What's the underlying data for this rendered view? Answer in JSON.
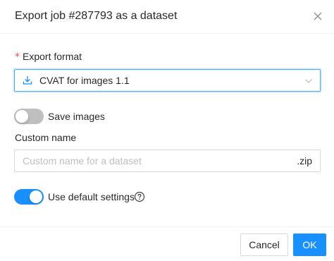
{
  "dialog": {
    "title": "Export job #287793 as a dataset",
    "close_icon": "close-icon"
  },
  "format": {
    "required_mark": "*",
    "label": "Export format",
    "selected": "CVAT for images 1.1",
    "icon": "download-icon",
    "dropdown_icon": "chevron-down-icon"
  },
  "save_images": {
    "label": "Save images",
    "enabled": false
  },
  "custom_name": {
    "label": "Custom name",
    "value": "",
    "placeholder": "Custom name for a dataset",
    "suffix": ".zip"
  },
  "default_settings": {
    "label": "Use default settings",
    "enabled": true,
    "help_icon": "question-circle-icon"
  },
  "footer": {
    "cancel_label": "Cancel",
    "ok_label": "OK"
  },
  "colors": {
    "primary": "#1890ff",
    "required": "#ff4d4f",
    "switch_off": "#bfbfbf",
    "border": "#d9d9d9"
  }
}
